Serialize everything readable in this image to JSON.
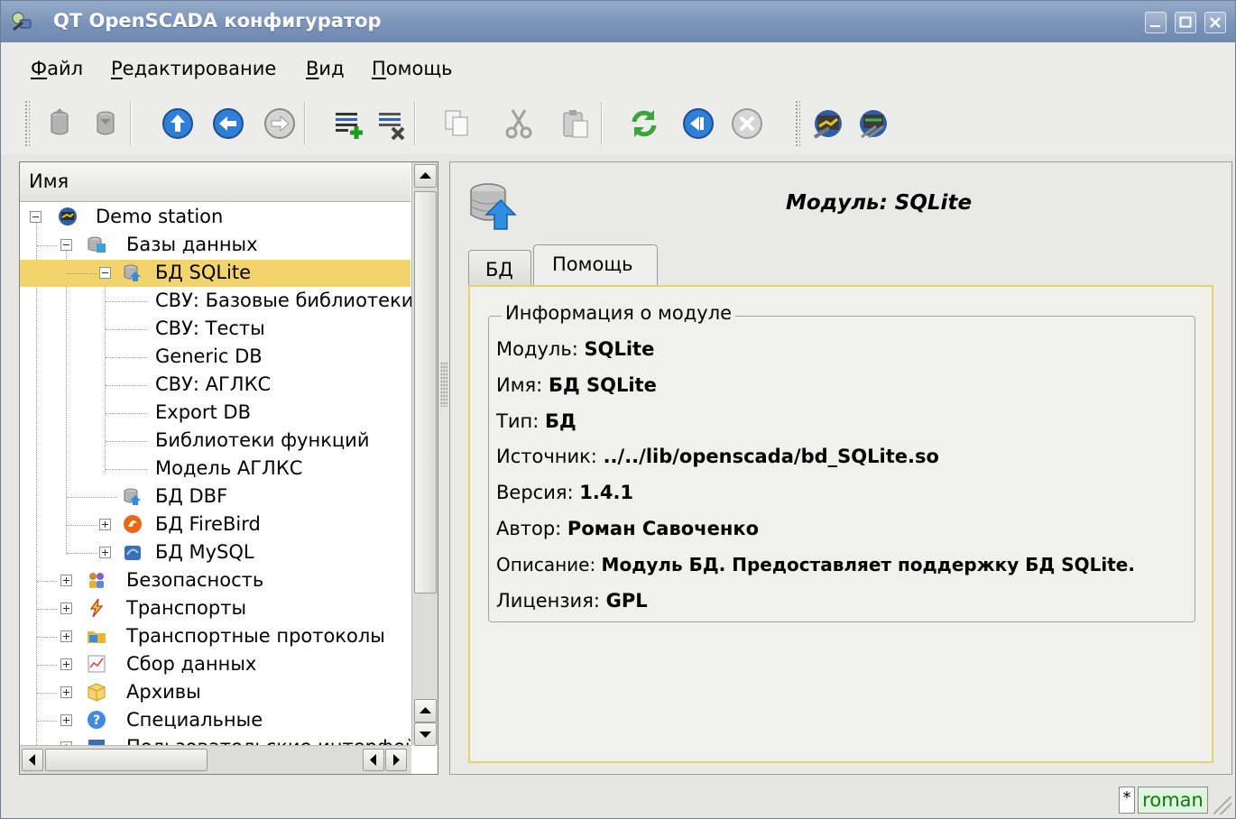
{
  "window": {
    "title": "QT OpenSCADA конфигуратор"
  },
  "menu": [
    {
      "u": "Ф",
      "rest": "айл"
    },
    {
      "u": "Р",
      "rest": "едактирование"
    },
    {
      "u": "В",
      "rest": "ид"
    },
    {
      "u": "П",
      "rest": "омощь"
    }
  ],
  "toolbar": {
    "icons": [
      "db-load-icon",
      "db-save-icon",
      "up-icon",
      "back-icon",
      "forward-icon",
      "add-item-icon",
      "delete-item-icon",
      "copy-icon",
      "cut-icon",
      "paste-icon",
      "refresh-icon",
      "start-icon",
      "stop-icon",
      "station-icon",
      "config-icon"
    ]
  },
  "tree": {
    "header": "Имя",
    "items": [
      {
        "label": "Demo station"
      },
      {
        "label": "Базы данных"
      },
      {
        "label": "БД SQLite"
      },
      {
        "label": "СВУ: Базовые библиотеки"
      },
      {
        "label": "СВУ: Тесты"
      },
      {
        "label": "Generic DB"
      },
      {
        "label": "СВУ: АГЛКС"
      },
      {
        "label": "Export DB"
      },
      {
        "label": "Библиотеки функций"
      },
      {
        "label": "Модель АГЛКС"
      },
      {
        "label": "БД DBF"
      },
      {
        "label": "БД FireBird"
      },
      {
        "label": "БД MySQL"
      },
      {
        "label": "Безопасность"
      },
      {
        "label": "Транспорты"
      },
      {
        "label": "Транспортные протоколы"
      },
      {
        "label": "Сбор данных"
      },
      {
        "label": "Архивы"
      },
      {
        "label": "Специальные"
      },
      {
        "label": "Пользовательские интерфейсы"
      }
    ]
  },
  "module": {
    "title": "Модуль: SQLite",
    "tabs": [
      "БД",
      "Помощь"
    ],
    "group_title": "Информация о модуле",
    "fields": [
      {
        "label": "Модуль:",
        "value": "SQLite"
      },
      {
        "label": "Имя:",
        "value": "БД SQLite"
      },
      {
        "label": "Тип:",
        "value": "БД"
      },
      {
        "label": "Источник:",
        "value": "../../lib/openscada/bd_SQLite.so"
      },
      {
        "label": "Версия:",
        "value": "1.4.1"
      },
      {
        "label": "Автор:",
        "value": "Роман Савоченко"
      },
      {
        "label": "Описание:",
        "value": "Модуль БД. Предоставляет поддержку БД SQLite."
      },
      {
        "label": "Лицензия:",
        "value": "GPL"
      }
    ]
  },
  "status": {
    "modified": "*",
    "user": "roman"
  }
}
